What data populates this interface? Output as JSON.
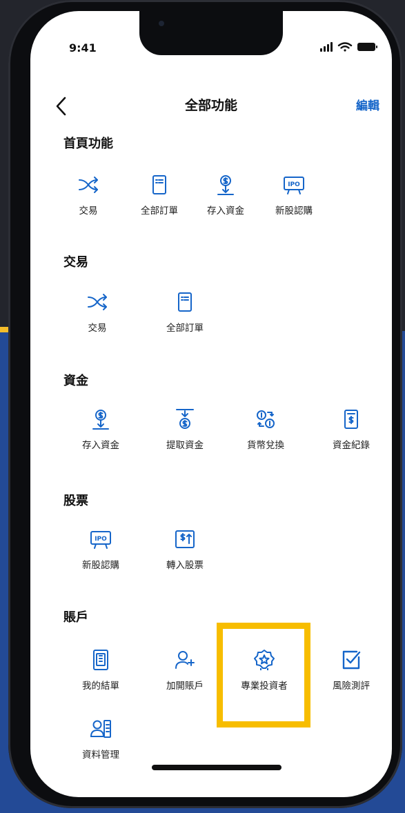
{
  "status_bar": {
    "time": "9:41"
  },
  "header": {
    "title": "全部功能",
    "edit_label": "編輯"
  },
  "sections": {
    "home": {
      "title": "首頁功能",
      "items": [
        {
          "label": "交易",
          "icon": "shuffle-icon"
        },
        {
          "label": "全部訂單",
          "icon": "order-list-icon"
        },
        {
          "label": "存入資金",
          "icon": "deposit-icon"
        },
        {
          "label": "新股認購",
          "icon": "ipo-icon"
        }
      ]
    },
    "trade": {
      "title": "交易",
      "items": [
        {
          "label": "交易",
          "icon": "shuffle-icon"
        },
        {
          "label": "全部訂單",
          "icon": "order-list-icon"
        }
      ]
    },
    "funds": {
      "title": "資金",
      "items": [
        {
          "label": "存入資金",
          "icon": "deposit-icon"
        },
        {
          "label": "提取資金",
          "icon": "withdraw-icon"
        },
        {
          "label": "貨幣兌換",
          "icon": "currency-exchange-icon"
        },
        {
          "label": "資金紀錄",
          "icon": "fund-record-icon"
        }
      ]
    },
    "stocks": {
      "title": "股票",
      "items": [
        {
          "label": "新股認購",
          "icon": "ipo-icon"
        },
        {
          "label": "轉入股票",
          "icon": "transfer-stock-icon"
        }
      ]
    },
    "account": {
      "title": "賬戶",
      "items": [
        {
          "label": "我的結單",
          "icon": "statement-icon"
        },
        {
          "label": "加開賬戶",
          "icon": "add-account-icon"
        },
        {
          "label": "專業投資者",
          "icon": "professional-investor-badge-icon"
        },
        {
          "label": "風險測評",
          "icon": "risk-assessment-icon"
        },
        {
          "label": "資料管理",
          "icon": "profile-management-icon"
        }
      ]
    }
  },
  "colors": {
    "accent": "#1565c9",
    "highlight": "#f7bd00",
    "background_blue": "#234a96"
  }
}
